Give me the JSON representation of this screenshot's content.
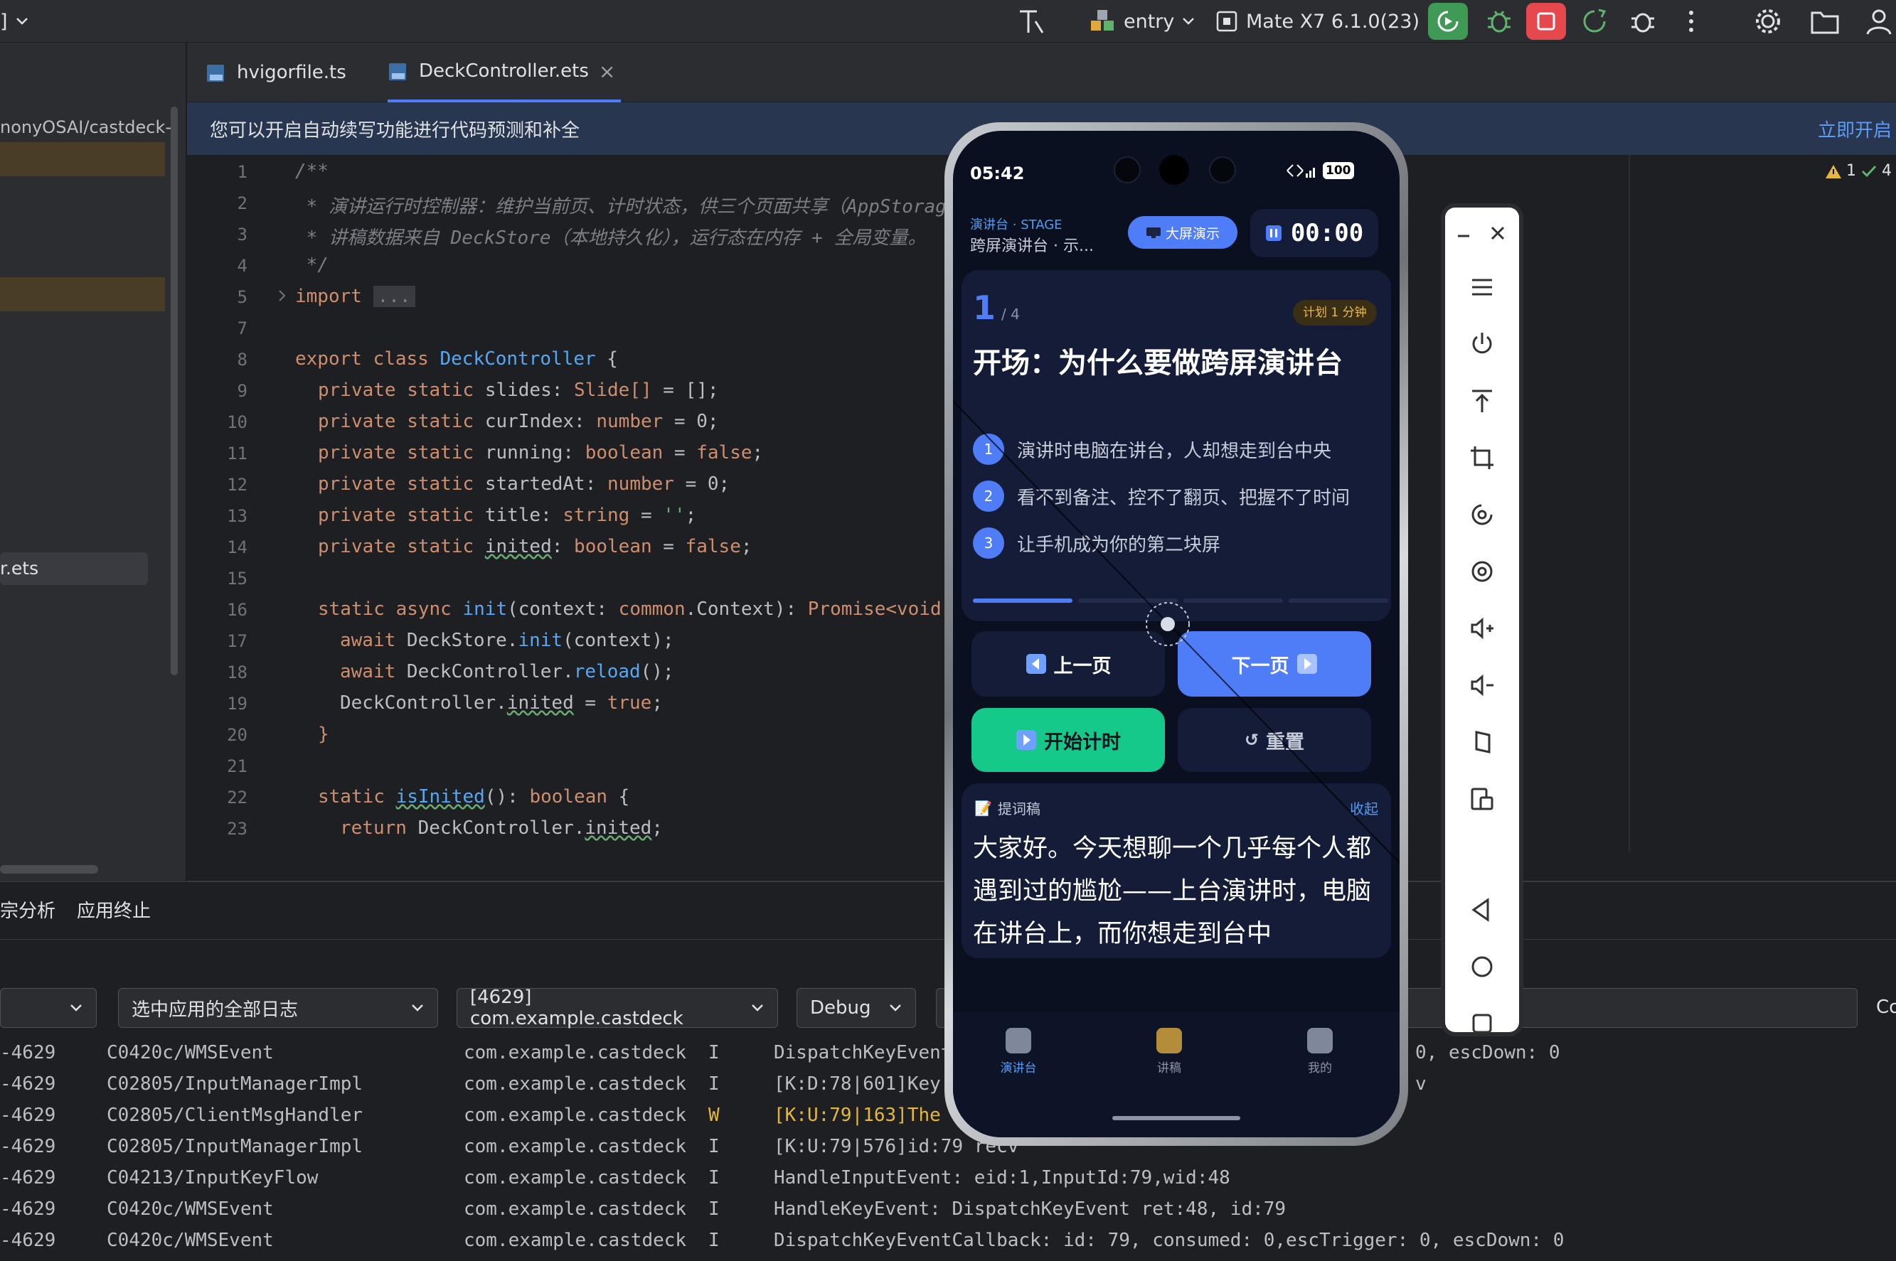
{
  "topbar": {
    "left_fragment": "]",
    "config": "entry",
    "device": "Mate X7 6.1.0(23)",
    "colors": {
      "run_green": "#3f9a55",
      "stop_red": "#e5484d"
    }
  },
  "leftpanel": {
    "path_fragment": "nonyOSAI/castdeck-",
    "file_fragment": "r.ets"
  },
  "tabs": [
    {
      "label": "hvigorfile.ts"
    },
    {
      "label": "DeckController.ets",
      "close": "×"
    }
  ],
  "banner": {
    "text": "您可以开启自动续写功能进行代码预测和补全",
    "action": "立即开启"
  },
  "inspection": {
    "warnings": "1",
    "checks": "4"
  },
  "code": {
    "line_numbers": [
      "1",
      "2",
      "3",
      "4",
      "5",
      "7",
      "8",
      "9",
      "10",
      "11",
      "12",
      "13",
      "14",
      "15",
      "16",
      "17",
      "18",
      "19",
      "20",
      "21",
      "22",
      "23"
    ],
    "l1": "/**",
    "l2": " * 演讲运行时控制器：维护当前页、计时状态，供三个页面共享（AppStorag",
    "l3": " * 讲稿数据来自 DeckStore（本地持久化），运行态在内存 + 全局变量。",
    "l4": " */",
    "l5_kw": "import",
    "l5_fold": "...",
    "l8_kw": "export class ",
    "l8_cl": "DeckController",
    "l8_br": " {",
    "fields": [
      {
        "kw": "private static ",
        "name": "slides",
        "sep": ": ",
        "type": "Slide[]",
        "rest": " = [];"
      },
      {
        "kw": "private static ",
        "name": "curIndex",
        "sep": ": ",
        "type": "number",
        "rest": " = 0;"
      },
      {
        "kw": "private static ",
        "name": "running",
        "sep": ": ",
        "type": "boolean",
        "rest": " = ",
        "val": "false",
        "end": ";"
      },
      {
        "kw": "private static ",
        "name": "startedAt",
        "sep": ": ",
        "type": "number",
        "rest": " = 0;"
      },
      {
        "kw": "private static ",
        "name": "title",
        "sep": ": ",
        "type": "string",
        "rest": " = ",
        "val": "''",
        "end": ";"
      },
      {
        "kw": "private static ",
        "name": "inited",
        "sep": ": ",
        "type": "boolean",
        "rest": " = ",
        "val": "false",
        "end": ";"
      }
    ],
    "l16_kw": "static async ",
    "l16_fn": "init",
    "l16_a": "(context: ",
    "l16_ns": "common",
    "l16_b": ".Context): ",
    "l16_ty": "Promise<void",
    "l17_kw": "await ",
    "l17_a": "DeckStore.",
    "l17_fn": "init",
    "l17_b": "(context);",
    "l18_kw": "await ",
    "l18_a": "DeckController.",
    "l18_fn": "reload",
    "l18_b": "();",
    "l19_a": "DeckController.",
    "l19_w": "inited",
    "l19_b": " = ",
    "l19_v": "true",
    "l19_c": ";",
    "l20": "}",
    "l22_kw": "static ",
    "l22_fn": "isInited",
    "l22_a": "(): ",
    "l22_ty": "boolean",
    "l22_b": " {",
    "l23_kw": "return ",
    "l23_a": "DeckController.",
    "l23_w": "inited",
    "l23_b": ";"
  },
  "bottom": {
    "tab1": "宗分析",
    "tab2": "应用终止",
    "filter_all": "选中应用的全部日志",
    "process": "[4629] com.example.castdeck",
    "level": "Debug",
    "right_fragment": "Co",
    "logs": [
      {
        "pid": "-4629",
        "tag": "C0420c/WMSEvent",
        "pkg": "com.example.castdeck",
        "lvl": "I",
        "msg": "DispatchKeyEvent",
        "tail": "0, escDown: 0"
      },
      {
        "pid": "-4629",
        "tag": "C02805/InputManagerImpl",
        "pkg": "com.example.castdeck",
        "lvl": "I",
        "msg": "[K:D:78|601]Key",
        "tail": "v"
      },
      {
        "pid": "-4629",
        "tag": "C02805/ClientMsgHandler",
        "pkg": "com.example.castdeck",
        "lvl": "W",
        "msg": "[K:U:79|163]The",
        "tail": ""
      },
      {
        "pid": "-4629",
        "tag": "C02805/InputManagerImpl",
        "pkg": "com.example.castdeck",
        "lvl": "I",
        "msg": "[K:U:79|576]id:79 recv",
        "tail": ""
      },
      {
        "pid": "-4629",
        "tag": "C04213/InputKeyFlow",
        "pkg": "com.example.castdeck",
        "lvl": "I",
        "msg": "HandleInputEvent: eid:1,InputId:79,wid:48",
        "tail": ""
      },
      {
        "pid": "-4629",
        "tag": "C0420c/WMSEvent",
        "pkg": "com.example.castdeck",
        "lvl": "I",
        "msg": "HandleKeyEvent: DispatchKeyEvent ret:48, id:79",
        "tail": ""
      },
      {
        "pid": "-4629",
        "tag": "C0420c/WMSEvent",
        "pkg": "com.example.castdeck",
        "lvl": "I",
        "msg": "DispatchKeyEventCallback: id: 79, consumed: 0,escTrigger: 0, escDown: 0",
        "tail": ""
      }
    ]
  },
  "phone": {
    "time": "05:42",
    "battery": "100",
    "stage_cn": "演讲台",
    "stage_dot": "·",
    "stage_en": "STAGE",
    "deck_title": "跨屏演讲台 · 示...",
    "cast_btn": "大屏演示",
    "timer": "00:00",
    "slide_num": "1",
    "slide_total": "/ 4",
    "plan_badge": "计划 1 分钟",
    "slide_title": "开场：为什么要做跨屏演讲台",
    "bullets": [
      {
        "n": "1",
        "text": "演讲时电脑在讲台，人却想走到台中央"
      },
      {
        "n": "2",
        "text": "看不到备注、控不了翻页、把握不了时间"
      },
      {
        "n": "3",
        "text": "让手机成为你的第二块屏"
      }
    ],
    "progress": {
      "current": 1,
      "total": 4
    },
    "prev_btn": "上一页",
    "next_btn": "下一页",
    "start_btn": "开始计时",
    "reset_btn": "重置",
    "notes_label": "提词稿",
    "collapse": "收起",
    "notes_text": "大家好。今天想聊一个几乎每个人都遇到过的尴尬——上台演讲时，电脑在讲台上，而你想走到台中",
    "nav": [
      {
        "label": "演讲台",
        "active": true
      },
      {
        "label": "讲稿",
        "active": false
      },
      {
        "label": "我的",
        "active": false
      }
    ],
    "colors": {
      "accent": "#4f7cf7",
      "green": "#14c98a",
      "badge": "#e8b94a"
    }
  }
}
